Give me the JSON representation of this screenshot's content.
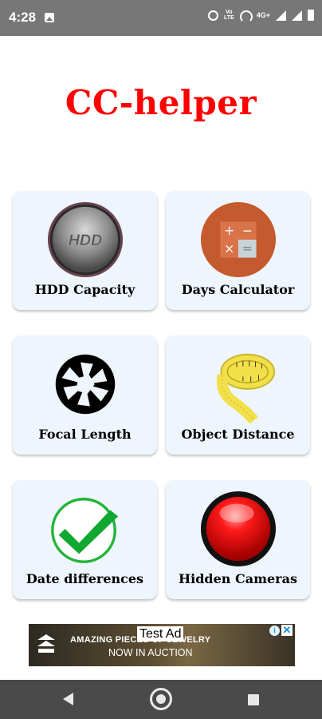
{
  "status_bar": {
    "time": "4:28",
    "volte_top": "Vo",
    "volte_bottom": "LTE",
    "network": "4G+",
    "icons": [
      "gallery-icon",
      "alarm-icon",
      "volte-icon",
      "hotspot-icon",
      "signal-icon",
      "signal-icon",
      "battery-icon"
    ]
  },
  "app": {
    "title": "CC-helper",
    "title_color": "#ff0000"
  },
  "tiles": [
    {
      "label": "HDD Capacity",
      "icon": "hdd-icon",
      "icon_text": "HDD"
    },
    {
      "label": "Days Calculator",
      "icon": "calculator-icon",
      "symbols": [
        "+",
        "−",
        "×",
        "="
      ]
    },
    {
      "label": "Focal Length",
      "icon": "aperture-icon"
    },
    {
      "label": "Object Distance",
      "icon": "measuring-tape-icon"
    },
    {
      "label": "Date differences",
      "icon": "checkmark-icon"
    },
    {
      "label": "Hidden Cameras",
      "icon": "red-button-icon"
    }
  ],
  "ad": {
    "label": "Test Ad",
    "headline": "AMAZING PIECES OF JEWELRY",
    "subline": "NOW IN AUCTION",
    "info": "i",
    "close": "✕"
  },
  "nav": {
    "icons": [
      "back-icon",
      "home-icon",
      "recents-icon"
    ]
  }
}
